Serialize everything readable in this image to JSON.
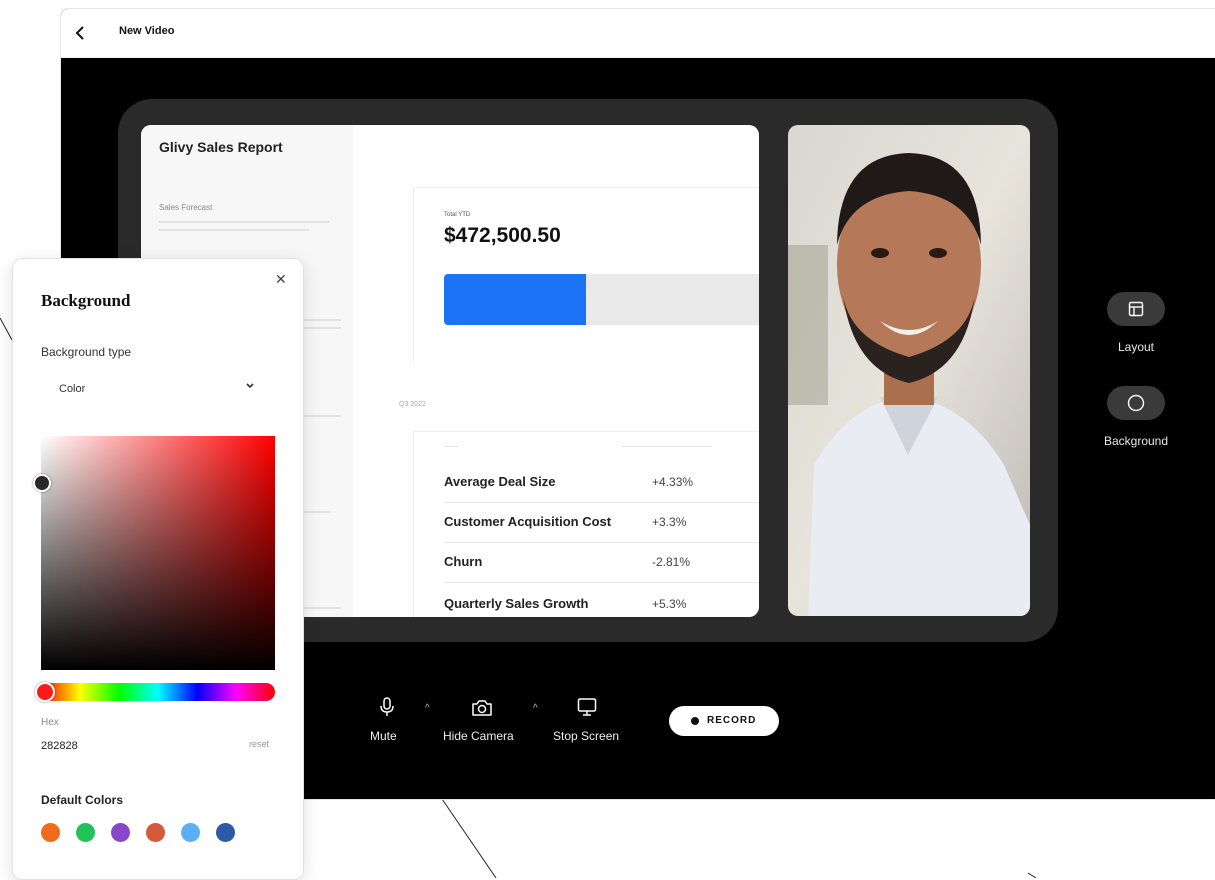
{
  "window": {
    "title": "New Video"
  },
  "slide": {
    "title": "Glivy Sales Report",
    "sales_forecast_label": "Sales Forecast",
    "ytd": {
      "label": "Total YTD",
      "value": "$472,500.50",
      "progress": 0.43
    },
    "quarter_label": "Q3 2022",
    "metrics": [
      {
        "name": "Average Deal Size",
        "value": "+4.33%"
      },
      {
        "name": "Customer Acquisition Cost",
        "value": "+3.3%"
      },
      {
        "name": "Churn",
        "value": "-2.81%"
      },
      {
        "name": "Quarterly Sales Growth",
        "value": "+5.3%"
      }
    ]
  },
  "side_panel": {
    "layout_label": "Layout",
    "layout_icon": "layout-icon",
    "background_label": "Background",
    "background_icon": "circle-icon"
  },
  "controls": {
    "mute_label": "Mute",
    "hide_camera_label": "Hide Camera",
    "stop_screen_label": "Stop Screen",
    "record_label": "RECORD"
  },
  "background_panel": {
    "title": "Background",
    "type_label": "Background type",
    "type_value": "Color",
    "hex_label": "Hex",
    "hex_value": "282828",
    "reset_label": "reset",
    "default_colors_title": "Default Colors",
    "default_colors": [
      "#f26a1b",
      "#22c25a",
      "#8a46c8",
      "#d45a3a",
      "#5ab0f5",
      "#2c5aa8"
    ]
  }
}
